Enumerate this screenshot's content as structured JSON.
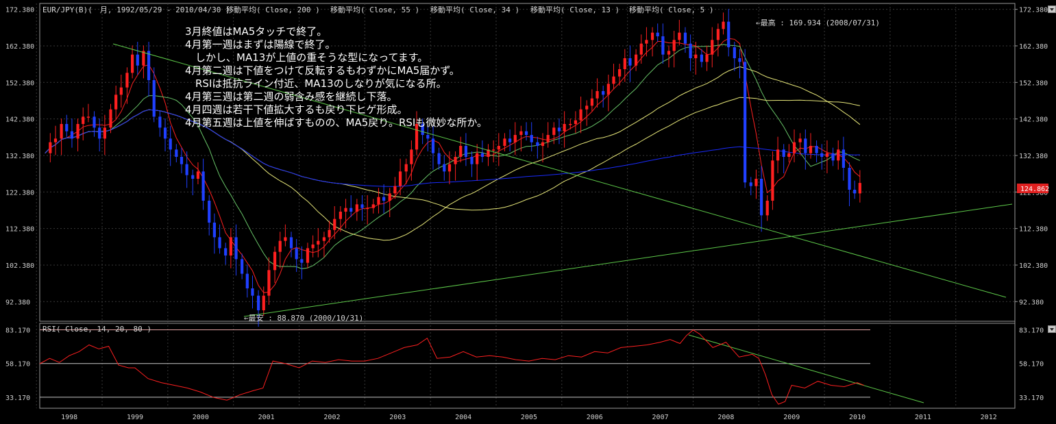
{
  "header": {
    "symbol": "EUR/JPY(B)(　月, 1992/05/29 - 2010/04/30 )",
    "ma_labels": [
      "移動平均( Close, 200 )",
      "移動平均( Close, 55 )",
      "移動平均( Close, 34 )",
      "移動平均( Close, 13 )",
      "移動平均( Close, 5 )"
    ]
  },
  "rsi_header": "RSI( Close, 14, 20, 80 )",
  "commentary": [
    "3月終値はMA5タッチで終了。",
    "4月第一週はまずは陽線で終了。",
    "　しかし、MA13が上値の重そうな型になってます。",
    "4月第二週は下値をつけて反転するもわずかにMA5届かず。",
    "　RSIは抵抗ライン付近、MA13のしなりが気になる所。",
    "4月第三週は第二週の弱含み感を継続し下落。",
    "4月四週は若干下値拡大するも戻り下ヒゲ形成。",
    "4月第五週は上値を伸ばすものの、MA5戻り。RSIも微妙な所か。"
  ],
  "annotations": {
    "high": "←最高 : 169.934 (2008/07/31)",
    "low": "←最安 : 88.870 (2000/10/31)"
  },
  "current_price": "124.862",
  "colors": {
    "background": "#000000",
    "bull": "#ff2020",
    "bear": "#2040ff",
    "ma200": "#1a2cff",
    "ma55": "#e8e87a",
    "ma34": "#e8e87a",
    "ma13": "#68c468",
    "ma5": "#ff2020",
    "trendline": "#5ecb4a",
    "rsi": "#ff2020",
    "price_tag": "#e02020"
  },
  "chart_data": [
    {
      "type": "candlestick",
      "title": "EUR/JPY(B)( 月, 1992/05/29 - 2010/04/30 )",
      "price_axis_ticks": [
        "172.380",
        "162.380",
        "152.380",
        "142.380",
        "132.380",
        "122.380",
        "112.380",
        "102.380",
        "92.380"
      ],
      "ylim": [
        87,
        174
      ],
      "time_axis_ticks": [
        "1998",
        "1999",
        "2000",
        "2001",
        "2002",
        "2003",
        "2004",
        "2005",
        "2006",
        "2007",
        "2008",
        "2009",
        "2010",
        "2011",
        "2012"
      ],
      "xlim": [
        1997.55,
        2012.4
      ],
      "candle_closes": [
        [
          1997.63,
          133
        ],
        [
          1997.71,
          136
        ],
        [
          1997.79,
          137
        ],
        [
          1997.88,
          141
        ],
        [
          1997.96,
          139
        ],
        [
          1998.04,
          137
        ],
        [
          1998.13,
          141
        ],
        [
          1998.21,
          143
        ],
        [
          1998.29,
          143
        ],
        [
          1998.38,
          140
        ],
        [
          1998.46,
          137
        ],
        [
          1998.54,
          140
        ],
        [
          1998.63,
          145
        ],
        [
          1998.71,
          149
        ],
        [
          1998.79,
          151
        ],
        [
          1998.88,
          155
        ],
        [
          1998.96,
          160
        ],
        [
          1999.04,
          157
        ],
        [
          1999.13,
          161
        ],
        [
          1999.21,
          153
        ],
        [
          1999.29,
          143
        ],
        [
          1999.38,
          140
        ],
        [
          1999.46,
          137
        ],
        [
          1999.54,
          134
        ],
        [
          1999.63,
          132
        ],
        [
          1999.71,
          130
        ],
        [
          1999.79,
          127
        ],
        [
          1999.88,
          126
        ],
        [
          1999.96,
          128
        ],
        [
          2000.04,
          120
        ],
        [
          2000.13,
          114
        ],
        [
          2000.21,
          110
        ],
        [
          2000.29,
          107
        ],
        [
          2000.38,
          105
        ],
        [
          2000.46,
          110
        ],
        [
          2000.54,
          104
        ],
        [
          2000.63,
          100
        ],
        [
          2000.71,
          96
        ],
        [
          2000.79,
          94
        ],
        [
          2000.88,
          90
        ],
        [
          2000.96,
          94
        ],
        [
          2001.04,
          101
        ],
        [
          2001.13,
          106
        ],
        [
          2001.21,
          109
        ],
        [
          2001.29,
          110
        ],
        [
          2001.38,
          107
        ],
        [
          2001.46,
          104
        ],
        [
          2001.54,
          103
        ],
        [
          2001.63,
          107
        ],
        [
          2001.71,
          108
        ],
        [
          2001.79,
          109
        ],
        [
          2001.88,
          110
        ],
        [
          2001.96,
          112
        ],
        [
          2002.04,
          115
        ],
        [
          2002.13,
          117
        ],
        [
          2002.21,
          118
        ],
        [
          2002.29,
          117
        ],
        [
          2002.38,
          119
        ],
        [
          2002.46,
          118
        ],
        [
          2002.54,
          118
        ],
        [
          2002.63,
          119
        ],
        [
          2002.71,
          121
        ],
        [
          2002.79,
          120
        ],
        [
          2002.88,
          122
        ],
        [
          2002.96,
          124
        ],
        [
          2003.04,
          128
        ],
        [
          2003.13,
          130
        ],
        [
          2003.21,
          134
        ],
        [
          2003.29,
          141
        ],
        [
          2003.38,
          138
        ],
        [
          2003.46,
          137
        ],
        [
          2003.54,
          133
        ],
        [
          2003.63,
          130
        ],
        [
          2003.71,
          128
        ],
        [
          2003.79,
          130
        ],
        [
          2003.88,
          132
        ],
        [
          2003.96,
          135
        ],
        [
          2004.04,
          132
        ],
        [
          2004.13,
          130
        ],
        [
          2004.21,
          133
        ],
        [
          2004.29,
          132
        ],
        [
          2004.38,
          134
        ],
        [
          2004.46,
          134
        ],
        [
          2004.54,
          135
        ],
        [
          2004.63,
          137
        ],
        [
          2004.71,
          136
        ],
        [
          2004.79,
          138
        ],
        [
          2004.88,
          139
        ],
        [
          2004.96,
          138
        ],
        [
          2005.04,
          136
        ],
        [
          2005.13,
          135
        ],
        [
          2005.21,
          136
        ],
        [
          2005.29,
          138
        ],
        [
          2005.38,
          140
        ],
        [
          2005.46,
          139
        ],
        [
          2005.54,
          141
        ],
        [
          2005.63,
          141
        ],
        [
          2005.71,
          142
        ],
        [
          2005.79,
          145
        ],
        [
          2005.88,
          146
        ],
        [
          2005.96,
          148
        ],
        [
          2006.04,
          150
        ],
        [
          2006.13,
          149
        ],
        [
          2006.21,
          152
        ],
        [
          2006.29,
          154
        ],
        [
          2006.38,
          156
        ],
        [
          2006.46,
          159
        ],
        [
          2006.54,
          157
        ],
        [
          2006.63,
          160
        ],
        [
          2006.71,
          163
        ],
        [
          2006.79,
          164
        ],
        [
          2006.88,
          166
        ],
        [
          2006.96,
          165
        ],
        [
          2007.04,
          160
        ],
        [
          2007.13,
          161
        ],
        [
          2007.21,
          164
        ],
        [
          2007.29,
          166
        ],
        [
          2007.38,
          163
        ],
        [
          2007.46,
          159
        ],
        [
          2007.54,
          160
        ],
        [
          2007.63,
          158
        ],
        [
          2007.71,
          160
        ],
        [
          2007.79,
          164
        ],
        [
          2007.88,
          167
        ],
        [
          2007.96,
          169
        ],
        [
          2008.04,
          162
        ],
        [
          2008.13,
          159
        ],
        [
          2008.21,
          158
        ],
        [
          2008.29,
          125
        ],
        [
          2008.38,
          124
        ],
        [
          2008.46,
          126
        ],
        [
          2008.54,
          116
        ],
        [
          2008.63,
          120
        ],
        [
          2008.71,
          131
        ],
        [
          2008.79,
          134
        ],
        [
          2008.88,
          132
        ],
        [
          2008.96,
          133
        ],
        [
          2009.04,
          136
        ],
        [
          2009.13,
          137
        ],
        [
          2009.21,
          133
        ],
        [
          2009.29,
          135
        ],
        [
          2009.38,
          133
        ],
        [
          2009.46,
          132
        ],
        [
          2009.54,
          133
        ],
        [
          2009.63,
          131
        ],
        [
          2009.71,
          134
        ],
        [
          2009.79,
          129
        ],
        [
          2009.88,
          123
        ],
        [
          2009.96,
          122
        ],
        [
          2010.04,
          124.86
        ]
      ],
      "high": 169.934,
      "low": 88.87
    },
    {
      "type": "line",
      "title": "RSI( Close, 14, 20, 80 )",
      "axis_ticks": [
        "83.170",
        "58.170",
        "33.170"
      ],
      "ylim": [
        25,
        88
      ],
      "reference_levels": [
        83.17,
        58.17,
        33.17
      ],
      "series": [
        {
          "name": "RSI",
          "x": [
            1997.55,
            1997.7,
            1997.85,
            1998.0,
            1998.15,
            1998.3,
            1998.45,
            1998.6,
            1998.75,
            1998.9,
            1999.0,
            1999.2,
            1999.4,
            1999.6,
            1999.8,
            2000.0,
            2000.2,
            2000.4,
            2000.6,
            2000.8,
            2000.95,
            2001.1,
            2001.3,
            2001.5,
            2001.7,
            2001.9,
            2002.1,
            2002.3,
            2002.5,
            2002.7,
            2002.9,
            2003.1,
            2003.3,
            2003.45,
            2003.6,
            2003.8,
            2004.0,
            2004.2,
            2004.4,
            2004.6,
            2004.8,
            2005.0,
            2005.2,
            2005.4,
            2005.6,
            2005.8,
            2006.0,
            2006.2,
            2006.4,
            2006.6,
            2006.8,
            2007.0,
            2007.15,
            2007.3,
            2007.4,
            2007.5,
            2007.6,
            2007.8,
            2008.0,
            2008.2,
            2008.3,
            2008.4,
            2008.5,
            2008.6,
            2008.7,
            2008.8,
            2008.9,
            2009.0,
            2009.2,
            2009.4,
            2009.6,
            2009.8,
            2010.0,
            2010.1
          ],
          "y": [
            58,
            62,
            59,
            64,
            67,
            72,
            69,
            71,
            57,
            55,
            55,
            47,
            44,
            42,
            40,
            37,
            33,
            31,
            35,
            38,
            40,
            60,
            58,
            55,
            60,
            59,
            61,
            60,
            60,
            62,
            66,
            70,
            72,
            77,
            62,
            63,
            67,
            63,
            64,
            63,
            61,
            60,
            62,
            61,
            64,
            63,
            67,
            66,
            70,
            71,
            72,
            74,
            76,
            73,
            79,
            83,
            80,
            70,
            74,
            63,
            64,
            65,
            62,
            50,
            35,
            28,
            30,
            42,
            40,
            45,
            42,
            41,
            44,
            42
          ]
        }
      ]
    }
  ]
}
